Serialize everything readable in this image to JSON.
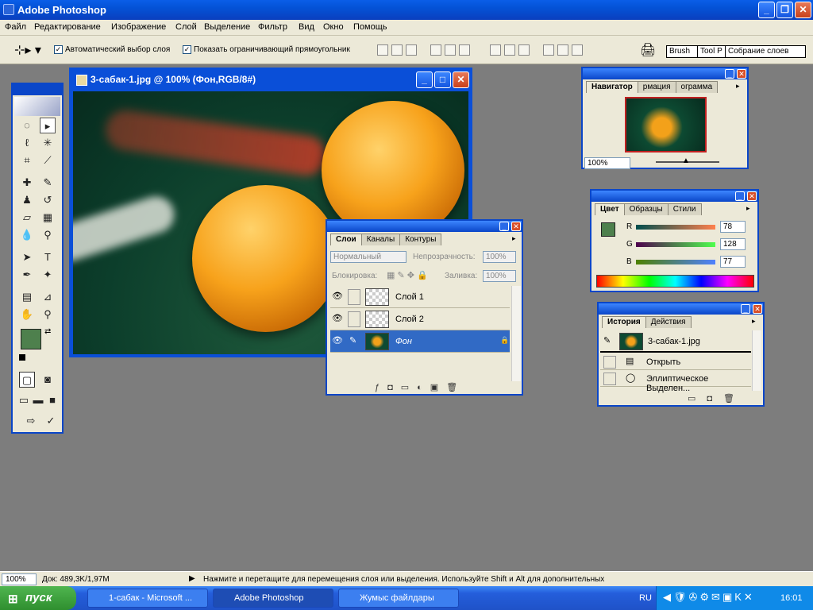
{
  "app": {
    "title": "Adobe Photoshop"
  },
  "menu": [
    "Файл",
    "Редактирование",
    "Изображение",
    "Слой",
    "Выделение",
    "Фильтр",
    "Вид",
    "Окно",
    "Помощь"
  ],
  "options": {
    "auto_select": "Автоматический выбор слоя",
    "show_bounds": "Показать ограничивающий прямоугольник",
    "tab_brush": "Brush",
    "tab_tool": "Tool P",
    "tab_collection": "Собрание слоев"
  },
  "document": {
    "title": "3-сабак-1.jpg @ 100% (Фон,RGB/8#)"
  },
  "navigator": {
    "tabs": [
      "Навигатор",
      "рмация",
      "ограмма"
    ],
    "zoom": "100%"
  },
  "color": {
    "tabs": [
      "Цвет",
      "Образцы",
      "Стили"
    ],
    "r_label": "R",
    "g_label": "G",
    "b_label": "B",
    "r": "78",
    "g": "128",
    "b": "77"
  },
  "layers": {
    "tabs": [
      "Слои",
      "Каналы",
      "Контуры"
    ],
    "blend_mode": "Нормальный",
    "opacity_label": "Непрозрачность:",
    "opacity": "100%",
    "lock_label": "Блокировка:",
    "fill_label": "Заливка:",
    "fill": "100%",
    "items": [
      "Слой 1",
      "Слой 2",
      "Фон"
    ]
  },
  "history": {
    "tabs": [
      "История",
      "Действия"
    ],
    "snapshot": "3-сабак-1.jpg",
    "steps": [
      "Открыть",
      "Эллиптическое Выделен..."
    ]
  },
  "status": {
    "zoom": "100%",
    "doc": "Док: 489,3K/1,97M",
    "hint": "Нажмите и перетащите для перемещения слоя или выделения. Используйте Shift и Alt для дополнительных"
  },
  "taskbar": {
    "start": "пуск",
    "items": [
      "1-сабак - Microsoft ...",
      "Adobe Photoshop",
      "Жумыс файлдары"
    ],
    "lang": "RU",
    "clock": "16:01"
  }
}
